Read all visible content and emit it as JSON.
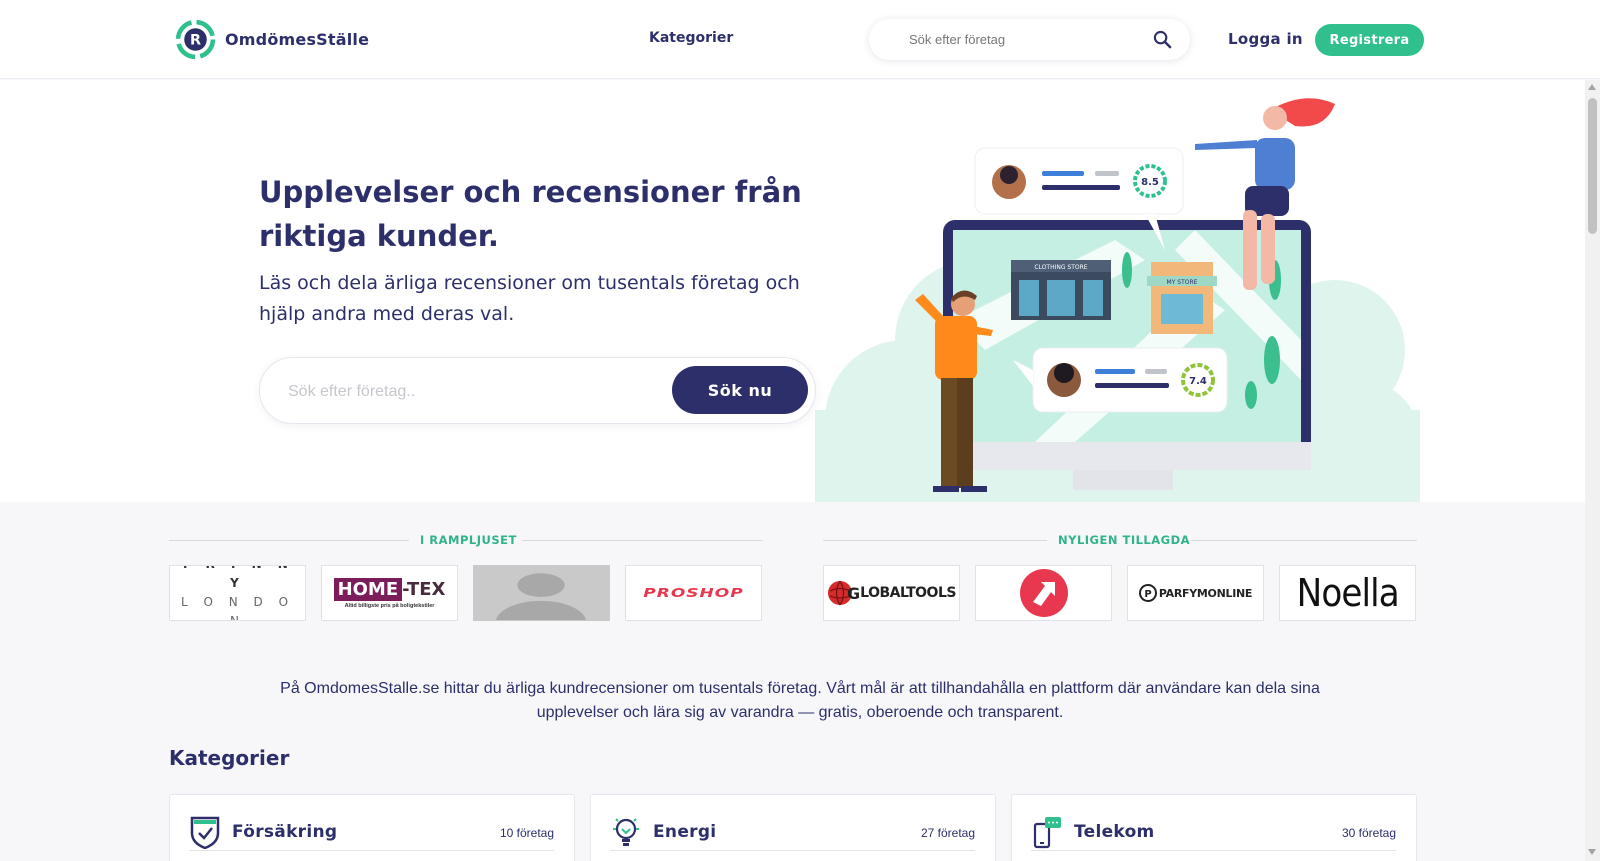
{
  "header": {
    "brand": "OmdömesStälle",
    "nav_categories": "Kategorier",
    "search_placeholder": "Sök efter företag",
    "login": "Logga in",
    "register": "Registrera"
  },
  "hero": {
    "title": "Upplevelser och recensioner från riktiga kunder.",
    "subtitle": "Läs och dela ärliga recensioner om tusentals företag och hjälp andra med deras val.",
    "search_placeholder": "Sök efter företag..",
    "search_button": "Sök nu",
    "illustration": {
      "rating_top": "8.5",
      "rating_bottom": "7.4",
      "store_sign_1": "CLOTHING STORE",
      "store_sign_2": "MY STORE"
    }
  },
  "spotlight": {
    "label": "I RAMPLJUSET",
    "logos": [
      {
        "name": "Trinny London",
        "line1": "T R I N N Y",
        "line2": "L O N D O N"
      },
      {
        "name": "Home-Tex",
        "main": "HOME",
        "suffix": "-TEX",
        "tagline": "Altid billigste pris på boligtekstiler"
      },
      {
        "name": "Placeholder"
      },
      {
        "name": "Proshop",
        "text": "PROSHOP"
      }
    ]
  },
  "recent": {
    "label": "NYLIGEN TILLAGDA",
    "logos": [
      {
        "name": "GlobalTools",
        "text": "LOBALTOOLS",
        "initial": "G"
      },
      {
        "name": "Red arrow logo"
      },
      {
        "name": "ParfymOnline",
        "text": "PARFYMONLINE"
      },
      {
        "name": "Noella",
        "text": "Noella"
      }
    ]
  },
  "about": "På OmdomesStalle.se hittar du ärliga kundrecensioner om tusentals företag. Vårt mål är att tillhandahålla en plattform där användare kan dela sina upplevelser och lära sig av varandra — gratis, oberoende och transparent.",
  "categories": {
    "heading": "Kategorier",
    "items": [
      {
        "name": "Försäkring",
        "count": "10 företag",
        "icon": "shield-check-icon"
      },
      {
        "name": "Energi",
        "count": "27 företag",
        "icon": "lightbulb-icon"
      },
      {
        "name": "Telekom",
        "count": "30 företag",
        "icon": "phone-chat-icon"
      }
    ]
  },
  "colors": {
    "brand_navy": "#2d2f6b",
    "brand_green": "#2fc08e",
    "accent_red": "#e8384f"
  }
}
